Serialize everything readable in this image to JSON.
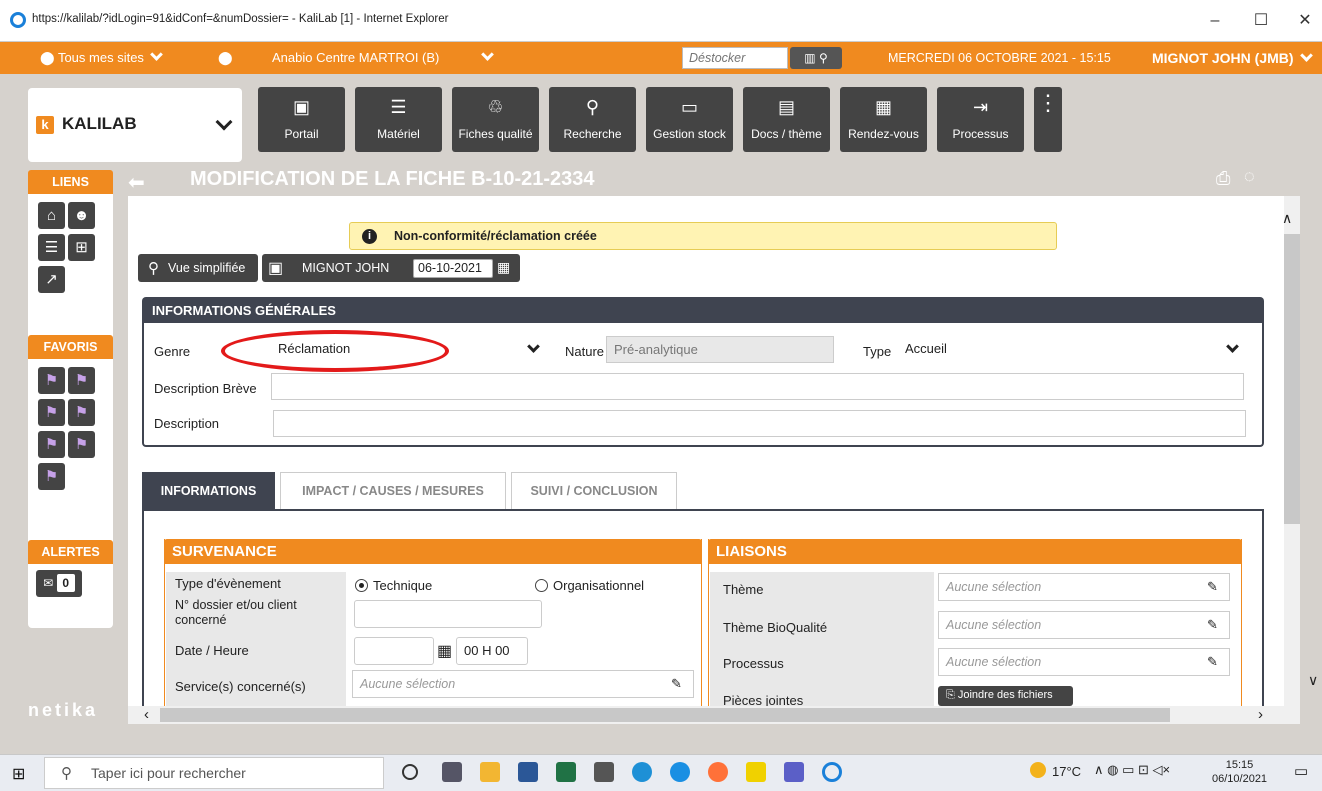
{
  "browser": {
    "title": "https://kalilab/?idLogin=91&idConf=&numDossier= - KaliLab [1] - Internet Explorer",
    "min": "–",
    "max": "☐",
    "close": "✕"
  },
  "topbar": {
    "sites": "Tous mes sites",
    "site_name": "Anabio Centre MARTROI (B)",
    "destocker_placeholder": "Déstocker",
    "datetime": "MERCREDI 06 OCTOBRE 2021 - 15:15",
    "user": "MIGNOT JOHN (JMB)"
  },
  "logo": {
    "k": "k",
    "name": "KALILAB"
  },
  "toolbar": [
    {
      "label": "Portail",
      "icon": "▣"
    },
    {
      "label": "Matériel",
      "icon": "☰"
    },
    {
      "label": "Fiches qualité",
      "icon": "♲"
    },
    {
      "label": "Recherche",
      "icon": "⚲"
    },
    {
      "label": "Gestion stock",
      "icon": "▭"
    },
    {
      "label": "Docs / thème",
      "icon": "▤"
    },
    {
      "label": "Rendez-vous",
      "icon": "▦"
    },
    {
      "label": "Processus",
      "icon": "⇥"
    }
  ],
  "toolbar_more": "⋮",
  "sidebar": {
    "liens": "LIENS",
    "favoris": "FAVORIS",
    "alertes": "ALERTES",
    "alert_count": "0",
    "brand": "netika"
  },
  "page": {
    "title": "MODIFICATION DE LA FICHE B-10-21-2334",
    "notice": "Non-conformité/réclamation créée",
    "vue_simplifiee": "Vue simplifiée",
    "author": "MIGNOT JOHN",
    "date": "06-10-2021"
  },
  "general": {
    "header": "INFORMATIONS GÉNÉRALES",
    "genre_label": "Genre",
    "genre_value": "Réclamation",
    "nature_label": "Nature",
    "nature_value": "Pré-analytique",
    "type_label": "Type",
    "type_value": "Accueil",
    "desc_breve_label": "Description Brève",
    "desc_label": "Description"
  },
  "tabs": [
    "INFORMATIONS",
    "IMPACT / CAUSES / MESURES",
    "SUIVI / CONCLUSION"
  ],
  "survenance": {
    "header": "SURVENANCE",
    "type_evt_label": "Type d'évènement",
    "opt_technique": "Technique",
    "opt_organisationnel": "Organisationnel",
    "dossier_label": "N° dossier et/ou client concerné",
    "date_heure_label": "Date / Heure",
    "heure_value": "00 H 00",
    "services_label": "Service(s) concerné(s)",
    "services_placeholder": "Aucune sélection"
  },
  "liaisons": {
    "header": "LIAISONS",
    "rows": [
      {
        "label": "Thème",
        "value": "Aucune sélection"
      },
      {
        "label": "Thème BioQualité",
        "value": "Aucune sélection"
      },
      {
        "label": "Processus",
        "value": "Aucune sélection"
      }
    ],
    "pieces_label": "Pièces jointes",
    "joindre": "Joindre des fichiers"
  },
  "taskbar": {
    "search": "Taper ici pour rechercher",
    "weather": "17°C",
    "time": "15:15",
    "date": "06/10/2021"
  }
}
